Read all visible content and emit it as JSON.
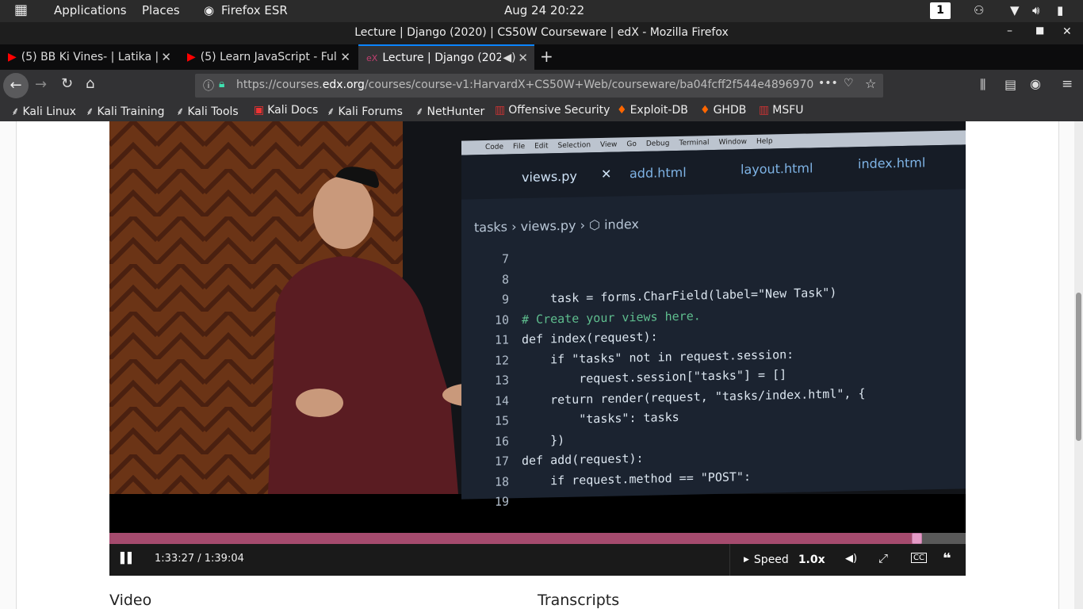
{
  "system_bar": {
    "applications": "Applications",
    "places": "Places",
    "browser": "Firefox ESR",
    "datetime": "Aug 24  20:22",
    "workspace": "1"
  },
  "window": {
    "title": "Lecture | Django (2020) | CS50W Courseware | edX - Mozilla Firefox"
  },
  "tabs": [
    {
      "label": "(5) BB Ki Vines- | Latika |"
    },
    {
      "label": "(5) Learn JavaScript - Full"
    },
    {
      "label": "Lecture | Django (2020"
    }
  ],
  "urlbar": {
    "url_prefix": "https://courses.",
    "url_domain": "edx.org",
    "url_rest": "/courses/course-v1:HarvardX+CS50W+Web/courseware/ba04fcff2f544e4896970"
  },
  "bookmarks": [
    "Kali Linux",
    "Kali Training",
    "Kali Tools",
    "Kali Docs",
    "Kali Forums",
    "NetHunter",
    "Offensive Security",
    "Exploit-DB",
    "GHDB",
    "MSFU"
  ],
  "video": {
    "editor_tabs": [
      "views.py",
      "add.html",
      "layout.html",
      "index.html"
    ],
    "breadcrumb": [
      "tasks",
      "views.py",
      "index"
    ],
    "menubar": [
      "Code",
      "File",
      "Edit",
      "Selection",
      "View",
      "Go",
      "Debug",
      "Terminal",
      "Window",
      "Help"
    ],
    "line_numbers": [
      "7",
      "8",
      "9",
      "10",
      "11",
      "12",
      "13",
      "14",
      "15",
      "16",
      "17",
      "18",
      "19"
    ],
    "code_lines": [
      "    task = forms.CharField(label=\"New Task\")",
      "",
      "# Create your views here.",
      "def index(request):",
      "    if \"tasks\" not in request.session:",
      "        request.session[\"tasks\"] = []",
      "",
      "    return render(request, \"tasks/index.html\", {",
      "        \"tasks\": tasks",
      "    })",
      "",
      "def add(request):",
      "    if request.method == \"POST\":"
    ]
  },
  "player": {
    "time": "1:33:27 / 1:39:04",
    "progress_fraction": 0.943,
    "speed_label": "Speed",
    "speed_value": "1.0x"
  },
  "sections": {
    "video_heading": "Video",
    "transcripts_heading": "Transcripts"
  },
  "colors": {
    "progress_fill": "#a54b6e",
    "progress_handle": "#e49ac6"
  }
}
